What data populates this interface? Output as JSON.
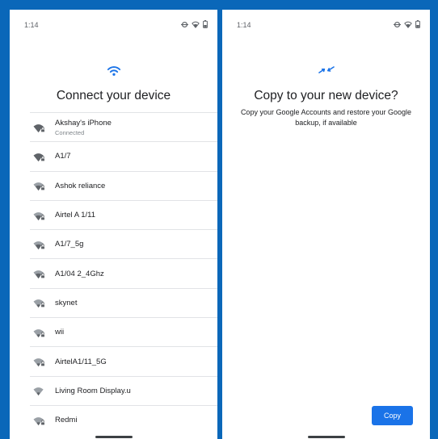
{
  "left_screen": {
    "status_time": "1:14",
    "title": "Connect your device",
    "networks": [
      {
        "name": "Akshay's iPhone",
        "status": "Connected"
      },
      {
        "name": "A1/7",
        "status": ""
      },
      {
        "name": "Ashok reliance",
        "status": ""
      },
      {
        "name": "Airtel A 1/11",
        "status": ""
      },
      {
        "name": "A1/7_5g",
        "status": ""
      },
      {
        "name": "A1/04 2_4Ghz",
        "status": ""
      },
      {
        "name": "skynet",
        "status": ""
      },
      {
        "name": "wii",
        "status": ""
      },
      {
        "name": "AirtelA1/11_5G",
        "status": ""
      },
      {
        "name": "Living Room Display.u",
        "status": ""
      },
      {
        "name": "Redmi",
        "status": ""
      }
    ]
  },
  "right_screen": {
    "status_time": "1:14",
    "title": "Copy to your new device?",
    "subtitle": "Copy your Google Accounts and restore your Google backup, if available",
    "copy_label": "Copy"
  },
  "icons": {
    "hero_left": "wifi-icon",
    "hero_right": "transfer-arrows-icon",
    "status": [
      "data-saver-icon",
      "wifi-icon",
      "battery-icon"
    ],
    "network": "wifi-lock-icon"
  },
  "colors": {
    "accent": "#1a73e8",
    "frame": "#0a67b9",
    "text": "#202124",
    "secondary_text": "#80868b",
    "divider": "#e1e3e6"
  }
}
